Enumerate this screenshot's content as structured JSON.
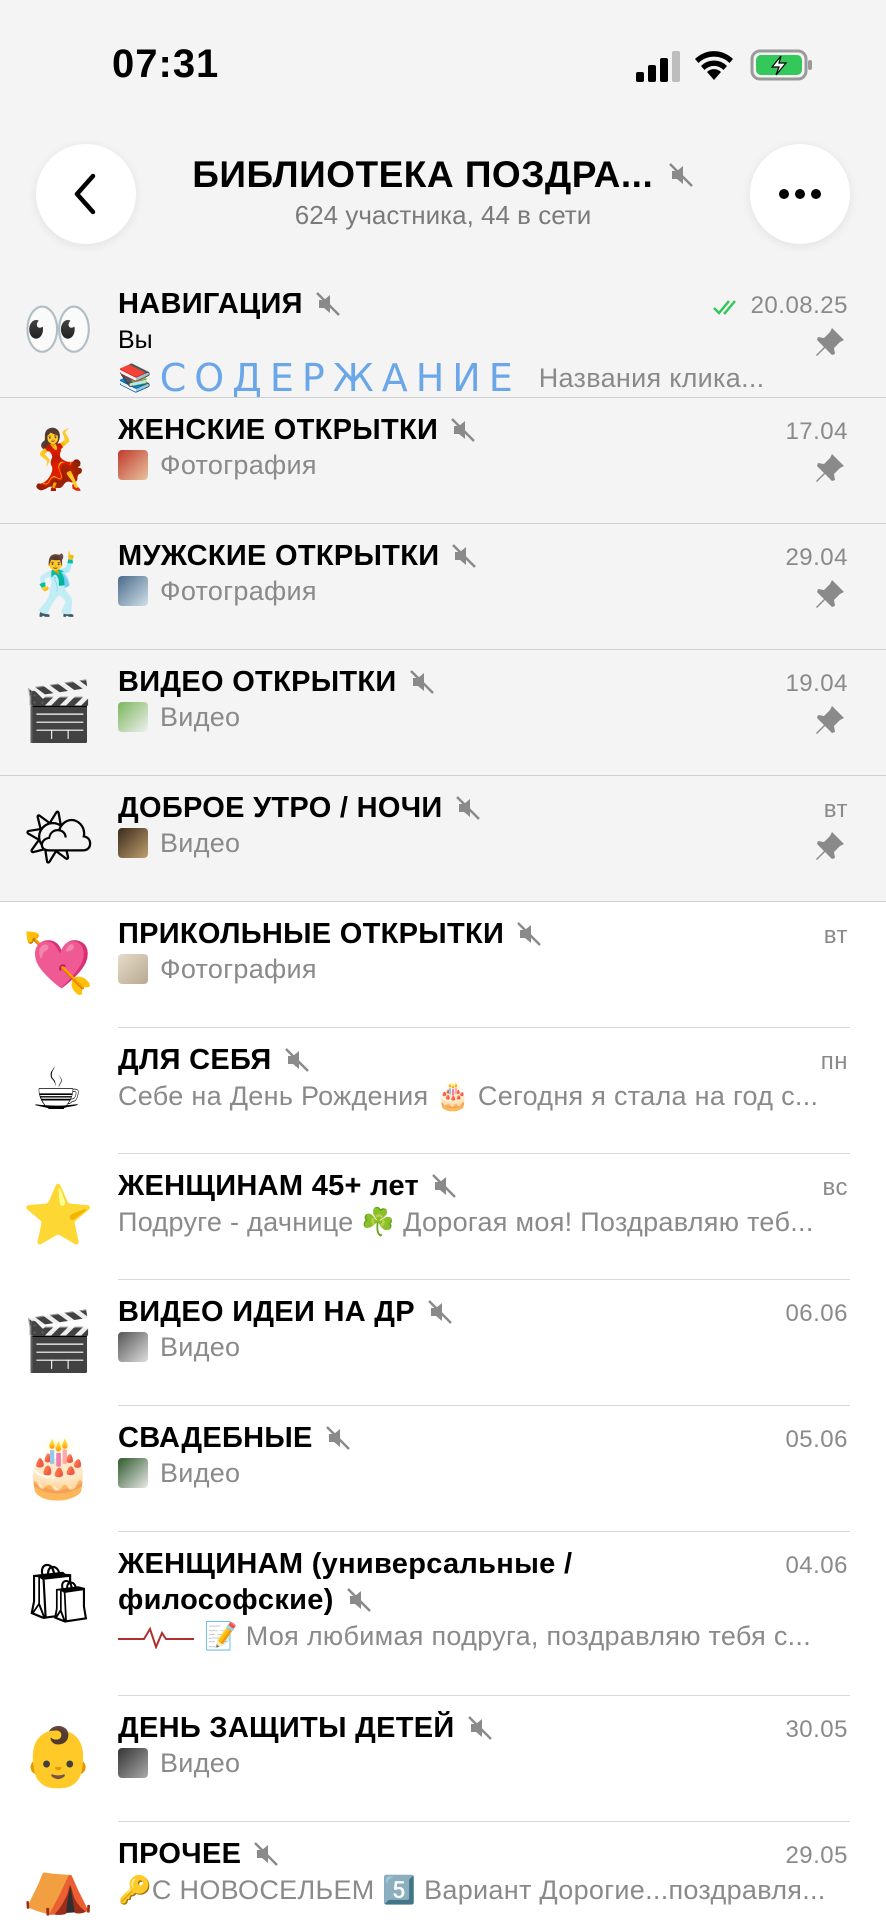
{
  "status": {
    "time": "07:31"
  },
  "header": {
    "title": "БИБЛИОТЕКА ПОЗДРА...",
    "subtitle": "624 участника, 44 в сети"
  },
  "chats": [
    {
      "name": "НАВИГАЦИЯ",
      "date": "20.08.25",
      "avatar": "👀",
      "pinned": true,
      "sender": "Вы",
      "preview_emoji": "📚",
      "preview_word": "СОДЕРЖАНИЕ",
      "preview": "Названия клика..."
    },
    {
      "name": "ЖЕНСКИЕ ОТКРЫТКИ",
      "date": "17.04",
      "avatar": "💃",
      "pinned": true,
      "preview": "Фотография"
    },
    {
      "name": "МУЖСКИЕ ОТКРЫТКИ",
      "date": "29.04",
      "avatar": "🕺",
      "pinned": true,
      "preview": "Фотография"
    },
    {
      "name": "ВИДЕО ОТКРЫТКИ",
      "date": "19.04",
      "avatar": "🎬",
      "pinned": true,
      "preview": "Видео"
    },
    {
      "name": "ДОБРОЕ УТРО / НОЧИ",
      "date": "вт",
      "avatar": "🌤",
      "pinned": true,
      "preview": "Видео"
    },
    {
      "name": "ПРИКОЛЬНЫЕ ОТКРЫТКИ",
      "date": "вт",
      "avatar": "💘",
      "pinned": false,
      "preview": "Фотография"
    },
    {
      "name": "ДЛЯ СЕБЯ",
      "date": "пн",
      "avatar": "☕",
      "pinned": false,
      "preview": "Себе на День Рождения 🎂 Сегодня я стала на год с..."
    },
    {
      "name": "ЖЕНЩИНАМ 45+ лет",
      "date": "вс",
      "avatar": "⭐",
      "pinned": false,
      "preview": "Подруге - дачнице ☘️ Дорогая моя! Поздравляю теб..."
    },
    {
      "name": "ВИДЕО ИДЕИ НА ДР",
      "date": "06.06",
      "avatar": "🎬",
      "pinned": false,
      "preview": "Видео"
    },
    {
      "name": "СВАДЕБНЫЕ",
      "date": "05.06",
      "avatar": "🎂",
      "pinned": false,
      "preview": "Видео"
    },
    {
      "name_line1": "ЖЕНЩИНАМ (универсальные /",
      "name_line2": "философские)",
      "date": "04.06",
      "avatar": "🛍",
      "pinned": false,
      "preview": "📝 Моя любимая подруга, поздравляю тебя с..."
    },
    {
      "name": "ДЕНЬ ЗАЩИТЫ ДЕТЕЙ",
      "date": "30.05",
      "avatar": "👶",
      "pinned": false,
      "preview": "Видео"
    },
    {
      "name": "ПРОЧЕЕ",
      "date": "29.05",
      "avatar": "⛺",
      "pinned": false,
      "preview": "🔑С НОВОСЕЛЬЕМ 5️⃣ Вариант Дорогие...поздравля..."
    }
  ]
}
